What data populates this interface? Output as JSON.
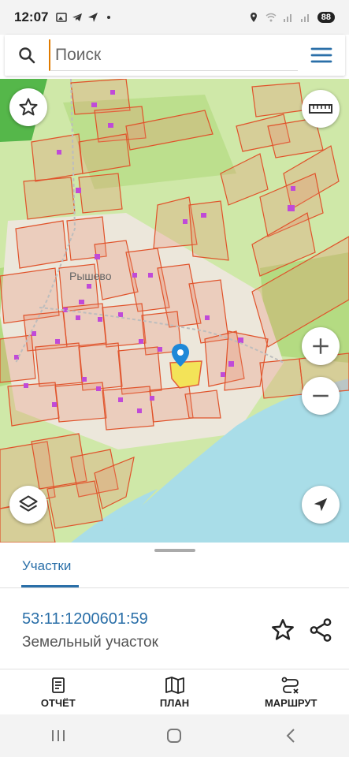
{
  "status_bar": {
    "time": "12:07",
    "battery": "88"
  },
  "search": {
    "placeholder": "Поиск",
    "value": ""
  },
  "map": {
    "place_label": "Рышево",
    "colors": {
      "forest": "#cfe8a8",
      "field": "#a8d47c",
      "settlement": "#ece7db",
      "water": "#a9dde8",
      "parcel_fill": "rgba(232,140,110,0.28)",
      "parcel_stroke": "#e0522a",
      "building": "#c04ad8",
      "selected": "#f4e34a",
      "marker": "#1e88d8"
    }
  },
  "sheet": {
    "tab_label": "Участки",
    "cadastral_number": "53:11:1200601:59",
    "parcel_type": "Земельный участок"
  },
  "bottom_nav": {
    "report": "ОТЧЁТ",
    "plan": "ПЛАН",
    "route": "МАРШРУТ"
  }
}
